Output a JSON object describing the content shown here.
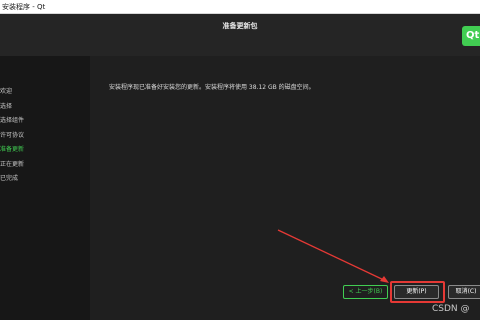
{
  "window": {
    "title": "安装程序 - Qt"
  },
  "header": {
    "title": "准备更新包",
    "logo_text": "Qt"
  },
  "sidebar": {
    "items": [
      {
        "label": "欢迎",
        "active": false
      },
      {
        "label": "选择",
        "active": false
      },
      {
        "label": "选择组件",
        "active": false
      },
      {
        "label": "许可协议",
        "active": false
      },
      {
        "label": "准备更新",
        "active": true
      },
      {
        "label": "正在更新",
        "active": false
      },
      {
        "label": "已完成",
        "active": false
      }
    ]
  },
  "content": {
    "message": "安装程序现已准备好安装您的更新。安装程序将使用 38.12 GB 的磁盘空间。"
  },
  "buttons": {
    "back": "< 上一步(B)",
    "next": "更新(P)",
    "cancel": "取消(C)"
  },
  "watermark": "CSDN @",
  "colors": {
    "accent": "#41cd52",
    "annotation": "#e53935"
  }
}
